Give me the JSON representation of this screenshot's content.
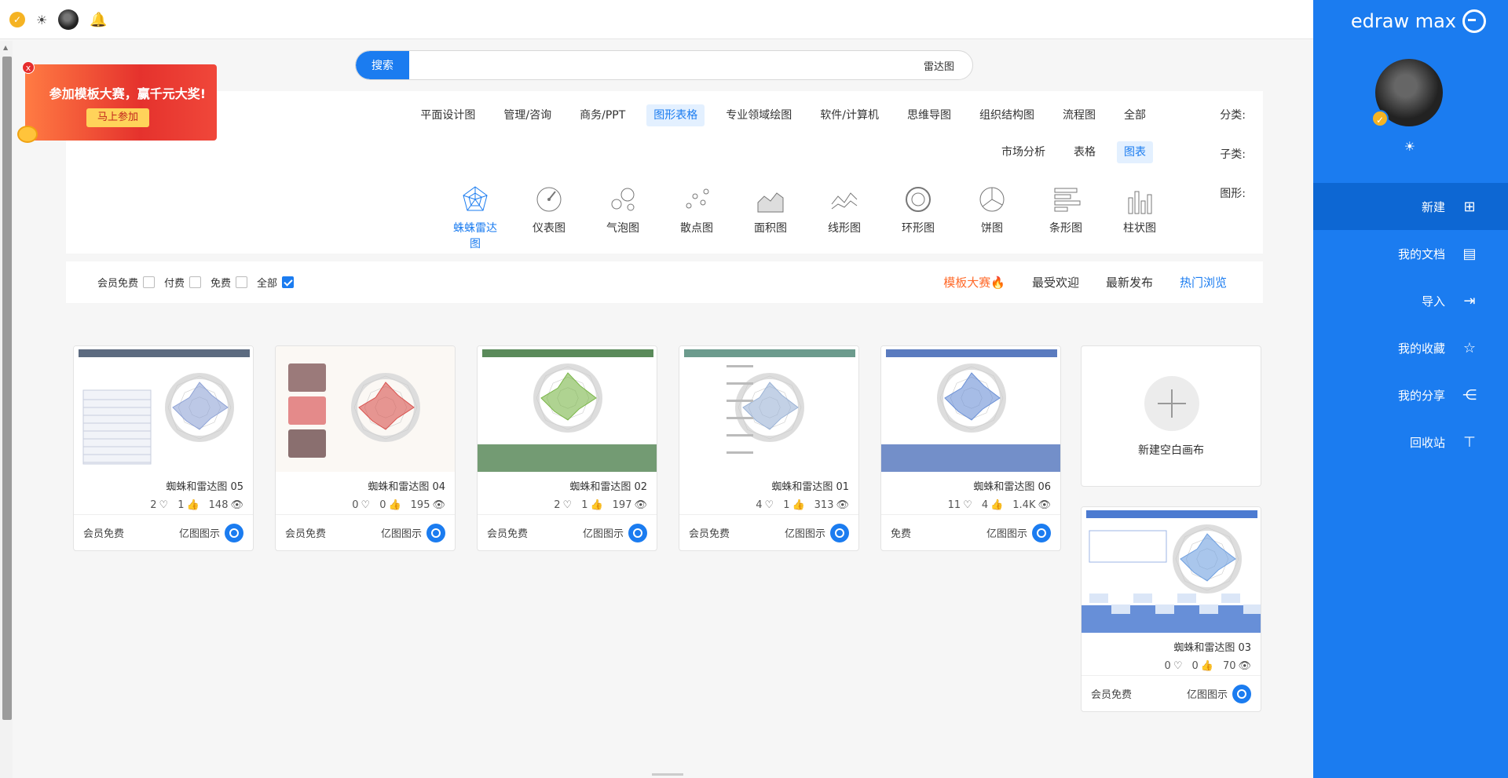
{
  "brand": {
    "name": "edraw max"
  },
  "sidebar": {
    "items": [
      {
        "label": "新建",
        "icon": "new-file-icon"
      },
      {
        "label": "我的文档",
        "icon": "my-docs-icon"
      },
      {
        "label": "导入",
        "icon": "import-icon"
      },
      {
        "label": "我的收藏",
        "icon": "star-icon"
      },
      {
        "label": "我的分享",
        "icon": "share-icon"
      },
      {
        "label": "回收站",
        "icon": "trash-icon"
      }
    ]
  },
  "search": {
    "button": "搜索",
    "value": "雷达图"
  },
  "promo": {
    "text": "参加模板大赛，赢千元大奖!",
    "button": "马上参加",
    "close": "x"
  },
  "filters": {
    "category_label": "分类:",
    "categories": [
      "全部",
      "流程图",
      "组织结构图",
      "思维导图",
      "软件/计算机",
      "专业领域绘图",
      "图形表格",
      "商务/PPT",
      "管理/咨询",
      "平面设计图"
    ],
    "active_category": "图形表格",
    "subcategory_label": "子类:",
    "subcategories": [
      "图表",
      "表格",
      "市场分析"
    ],
    "active_subcategory": "图表",
    "shape_label": "图形:",
    "shapes": [
      "柱状图",
      "条形图",
      "饼图",
      "环形图",
      "线形图",
      "面积图",
      "散点图",
      "气泡图",
      "仪表图",
      "蛛蛛雷达图"
    ],
    "active_shape": "蛛蛛雷达图"
  },
  "sort": {
    "options": [
      "热门浏览",
      "最新发布",
      "最受欢迎"
    ],
    "active": "热门浏览",
    "contest": "模板大赛"
  },
  "price_filter": [
    {
      "label": "全部",
      "checked": true
    },
    {
      "label": "免费",
      "checked": false
    },
    {
      "label": "付费",
      "checked": false
    },
    {
      "label": "会员免费",
      "checked": false
    }
  ],
  "new_blank": {
    "label": "新建空白画布"
  },
  "cards": [
    {
      "title": "蜘蛛和雷达图 06",
      "views": "1.4K",
      "likes": "4",
      "favorites": "11",
      "author": "亿图图示",
      "price": "免费"
    },
    {
      "title": "蜘蛛和雷达图 01",
      "views": "313",
      "likes": "1",
      "favorites": "4",
      "author": "亿图图示",
      "price": "会员免费"
    },
    {
      "title": "蜘蛛和雷达图 02",
      "views": "197",
      "likes": "1",
      "favorites": "2",
      "author": "亿图图示",
      "price": "会员免费"
    },
    {
      "title": "蜘蛛和雷达图 04",
      "views": "195",
      "likes": "0",
      "favorites": "0",
      "author": "亿图图示",
      "price": "会员免费"
    },
    {
      "title": "蜘蛛和雷达图 05",
      "views": "148",
      "likes": "1",
      "favorites": "2",
      "author": "亿图图示",
      "price": "会员免费"
    },
    {
      "title": "蜘蛛和雷达图 03",
      "views": "70",
      "likes": "0",
      "favorites": "0",
      "author": "亿图图示",
      "price": "会员免费"
    }
  ],
  "colors": {
    "accent": "#1b7cf0",
    "contest": "#ff6a2a",
    "promo": "#e5322d"
  }
}
